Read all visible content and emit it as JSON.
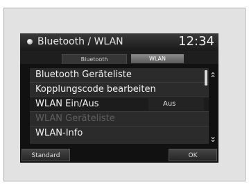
{
  "header": {
    "title": "Bluetooth / WLAN",
    "clock": "12:34"
  },
  "tabs": [
    {
      "label": "Bluetooth",
      "selected": false
    },
    {
      "label": "WLAN",
      "selected": true
    }
  ],
  "list": {
    "items": [
      {
        "label": "Bluetooth Geräteliste",
        "value": "",
        "enabled": true
      },
      {
        "label": "Kopplungscode bearbeiten",
        "value": "",
        "enabled": true
      },
      {
        "label": "WLAN Ein/Aus",
        "value": "Aus",
        "enabled": true
      },
      {
        "label": "WLAN Geräteliste",
        "value": "",
        "enabled": false
      },
      {
        "label": "WLAN-Info",
        "value": "",
        "enabled": true
      }
    ]
  },
  "footer": {
    "standard_label": "Standard",
    "ok_label": "OK"
  },
  "icons": {
    "bluetooth": "bluetooth-icon",
    "scroll_up": "double-chevron-up-icon",
    "scroll_down": "double-chevron-down-icon"
  }
}
